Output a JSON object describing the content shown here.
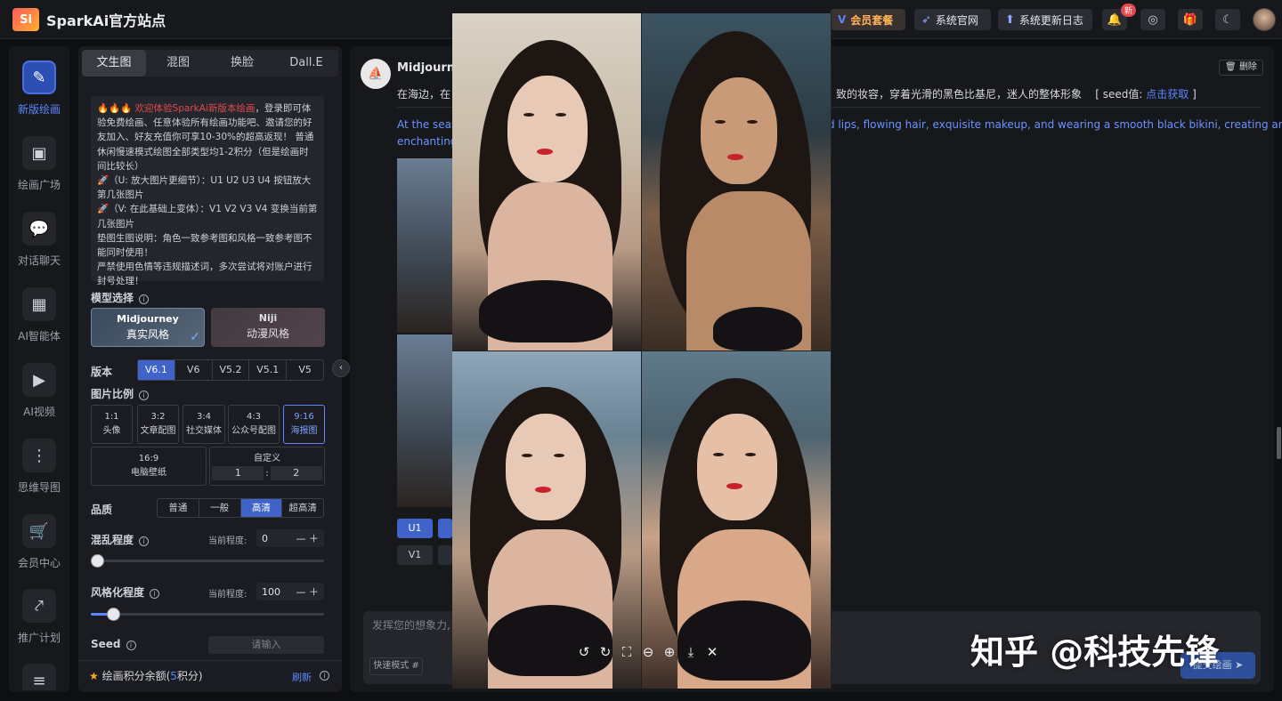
{
  "header": {
    "logo_mark": "Si",
    "logo_text": "SparkAi官方站点",
    "vip_label": "会员套餐",
    "official_label": "系统官网",
    "changelog_label": "系统更新日志",
    "notify_badge": "新"
  },
  "nav": {
    "items": [
      {
        "label": "新版绘画",
        "icon": "✎"
      },
      {
        "label": "绘画广场",
        "icon": "▣"
      },
      {
        "label": "对话聊天",
        "icon": "💬"
      },
      {
        "label": "AI智能体",
        "icon": "▦"
      },
      {
        "label": "AI视频",
        "icon": "▶"
      },
      {
        "label": "思维导图",
        "icon": "⋮"
      },
      {
        "label": "会员中心",
        "icon": "🛒"
      },
      {
        "label": "推广计划",
        "icon": "⤤"
      },
      {
        "label": "",
        "icon": "≡"
      }
    ]
  },
  "panel": {
    "tabs": [
      "文生图",
      "混图",
      "换脸",
      "Dall.E"
    ],
    "notice": {
      "line1_prefix": "🔥🔥🔥 ",
      "line1_red": "欢迎体验SparkAi新版本绘画",
      "line1_rest": "，登录即可体验免费绘画、任意体验所有绘画功能吧、邀请您的好友加入、好友充值你可享10-30%的超高返现！ 普通休闲慢速模式绘图全部类型均1-2积分（但是绘画时间比较长）",
      "line2": "🚀（U: 放大图片更细节）：U1 U2 U3 U4 按钮放大第几张图片",
      "line3": "🚀（V: 在此基础上变体）：V1 V2 V3 V4 变换当前第几张图片",
      "line4": "垫图生图说明：角色一致参考图和风格一致参考图不能同时使用！",
      "line5": "严禁使用色情等违规描述词，多次尝试将对账户进行封号处理！"
    },
    "model_section": "模型选择",
    "models": [
      {
        "name": "Midjourney",
        "style": "真实风格"
      },
      {
        "name": "Niji",
        "style": "动漫风格"
      }
    ],
    "version_label": "版本",
    "versions": [
      "V6.1",
      "V6",
      "V5.2",
      "V5.1",
      "V5"
    ],
    "ratio_label": "图片比例",
    "ratios": [
      {
        "value": "1:1",
        "name": "头像"
      },
      {
        "value": "3:2",
        "name": "文章配图"
      },
      {
        "value": "3:4",
        "name": "社交媒体"
      },
      {
        "value": "4:3",
        "name": "公众号配图"
      },
      {
        "value": "9:16",
        "name": "海报图"
      }
    ],
    "ratio_wide": {
      "value": "16:9",
      "name": "电脑壁纸"
    },
    "ratio_custom": {
      "name": "自定义",
      "w": "1",
      "sep": ":",
      "h": "2"
    },
    "quality_label": "品质",
    "qualities": [
      "普通",
      "一般",
      "高清",
      "超高清"
    ],
    "chaos_label": "混乱程度",
    "current_level_label": "当前程度:",
    "chaos_value": "0",
    "chaos_fraction": 0,
    "stylize_label": "风格化程度",
    "stylize_value": "100",
    "stylize_fraction": 0.1,
    "seed_label": "Seed",
    "seed_placeholder": "请输入",
    "credits_label": "绘画积分余额(",
    "credits_value": "5",
    "credits_unit": "积分)",
    "refresh_label": "刷新"
  },
  "main": {
    "author": "Midjourne",
    "delete_label": "删除",
    "prompt_cn_left": "在海边，在",
    "prompt_cn_right": "致的妆容，穿着光滑的黑色比基尼，迷人的整体形象",
    "seed_label": "[ seed值: ",
    "seed_link": "点击获取",
    "seed_close": " ]",
    "prompt_en_left1": "At the seasi",
    "prompt_en_right1": "d lips, flowing hair, exquisite makeup, and wearing a smooth black bikini, creating an",
    "prompt_en_left2": "enchanting",
    "u_buttons": [
      "U1",
      ""
    ],
    "v_buttons": [
      "V1",
      ""
    ],
    "input_placeholder": "发挥您的想象力,",
    "fast_mode": "快速模式 #",
    "submit_label": "提交绘画"
  },
  "viewer": {
    "tools": [
      "↺",
      "↻",
      "⛶",
      "⊖",
      "⊕",
      "⤓",
      "✕"
    ]
  },
  "watermark": "知乎 @科技先锋",
  "colors": {
    "accent": "#3f63c8",
    "link": "#5b86ff",
    "vip": "#ffb35a",
    "danger": "#e24b4b"
  }
}
